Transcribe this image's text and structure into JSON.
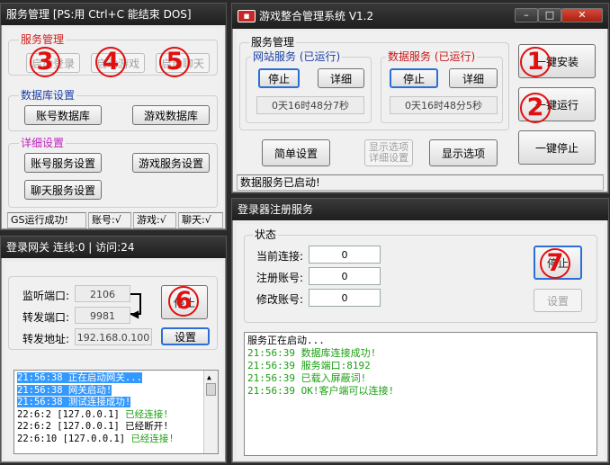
{
  "win_service": {
    "title": "服务管理 [PS:用 Ctrl+C 能结束 DOS]",
    "group_service": "服务管理",
    "btn_login": "启动登录",
    "btn_game": "启动游戏",
    "btn_chat": "启动聊天",
    "group_db": "数据库设置",
    "btn_accdb": "账号数据库",
    "btn_gamedb": "游戏数据库",
    "group_detail": "详细设置",
    "btn_accsvc": "账号服务设置",
    "btn_gamesvc": "游戏服务设置",
    "btn_chatsvc": "聊天服务设置",
    "status": [
      "GS运行成功!",
      "账号:√",
      "游戏:√",
      "聊天:√"
    ]
  },
  "win_main": {
    "title": "游戏整合管理系统 V1.2",
    "icon": "app-logo-icon",
    "group_service": "服务管理",
    "web": {
      "title": "网站服务 (已运行)",
      "stop": "停止",
      "detail": "详细",
      "time": "0天16时48分7秒"
    },
    "data": {
      "title": "数据服务 (已运行)",
      "stop": "停止",
      "detail": "详细",
      "time": "0天16时48分5秒"
    },
    "btn_install": "一键安装",
    "btn_run": "一键运行",
    "btn_stopall": "一键停止",
    "btn_simple": "简单设置",
    "btn_showopt": "显示选项\n详细设置",
    "btn_display": "显示选项",
    "status": "数据服务已启动!"
  },
  "win_gateway": {
    "title": "登录网关 连线:0 | 访问:24",
    "listen_label": "监听端口:",
    "listen_value": "2106",
    "forward_label": "转发端口:",
    "forward_value": "9981",
    "addr_label": "转发地址:",
    "addr_value": "192.168.0.100",
    "btn_stop": "停止",
    "btn_settings": "设置",
    "log": [
      {
        "t": "21:56:38 正在启动网关...",
        "c": "sel"
      },
      {
        "t": "21:56:38 网关启动!",
        "c": "sel"
      },
      {
        "t": "21:56:38 测试连接成功!",
        "c": "sel"
      },
      {
        "t": "22:6:2 [127.0.0.1] 已经连接!",
        "c": "mix",
        "a": "22:6:2 [127.0.0.1] ",
        "b": "已经连接!"
      },
      {
        "t": "22:6:2 [127.0.0.1] 已经断开!",
        "c": ""
      },
      {
        "t": "22:6:10 [127.0.0.1] 已经连接!",
        "c": "mix",
        "a": "22:6:10 [127.0.0.1] ",
        "b": "已经连接!"
      }
    ]
  },
  "win_register": {
    "title": "登录器注册服务",
    "group": "状态",
    "cur_label": "当前连接:",
    "cur_value": "0",
    "reg_label": "注册账号:",
    "reg_value": "0",
    "mod_label": "修改账号:",
    "mod_value": "0",
    "btn_stop": "停止",
    "btn_settings": "设置",
    "log": [
      {
        "t": "服务正在启动...",
        "c": ""
      },
      {
        "t": "21:56:39 数据库连接成功!",
        "c": "grn"
      },
      {
        "t": "21:56:39 服务端口:8192",
        "c": "grn"
      },
      {
        "t": "21:56:39 已载入屏蔽词!",
        "c": "grn"
      },
      {
        "t": "21:56:39 OK!客户端可以连接!",
        "c": "grn"
      }
    ]
  },
  "annotations": [
    "3",
    "4",
    "5",
    "1",
    "2",
    "6",
    "7"
  ],
  "colors": {
    "annotation": "#e01010",
    "titlebar": "#1e1e1e",
    "log_selected": "#3399ff",
    "log_green": "#1aa012"
  }
}
